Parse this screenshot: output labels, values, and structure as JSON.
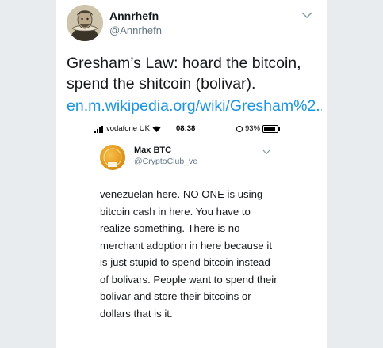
{
  "tweet": {
    "display_name": "Annrhefn",
    "handle": "@Annrhefn",
    "text": "Gresham’s Law: hoard the bitcoin, spend the shitcoin (bolivar).",
    "link": "en.m.wikipedia.org/wiki/Gresham%2..."
  },
  "screenshot": {
    "status_bar": {
      "carrier": "vodafone UK",
      "time": "08:38",
      "battery": "93%"
    },
    "inner_tweet": {
      "display_name": "Max BTC",
      "handle": "@CryptoClub_ve",
      "text": "venezuelan here. NO ONE is using bitcoin cash in here. You have to realize something. There is no merchant adoption in here because it is just stupid to spend bitcoin instead of bolivars. People want to spend their bolivar and store their bitcoins or dollars that is it."
    }
  },
  "colors": {
    "link": "#1b95e0",
    "handle": "#657786",
    "text": "#14171a",
    "background": "#e9ecef"
  },
  "icons": [
    "chevron-down-icon",
    "signal-icon",
    "wifi-icon",
    "alarm-icon",
    "battery-icon"
  ]
}
